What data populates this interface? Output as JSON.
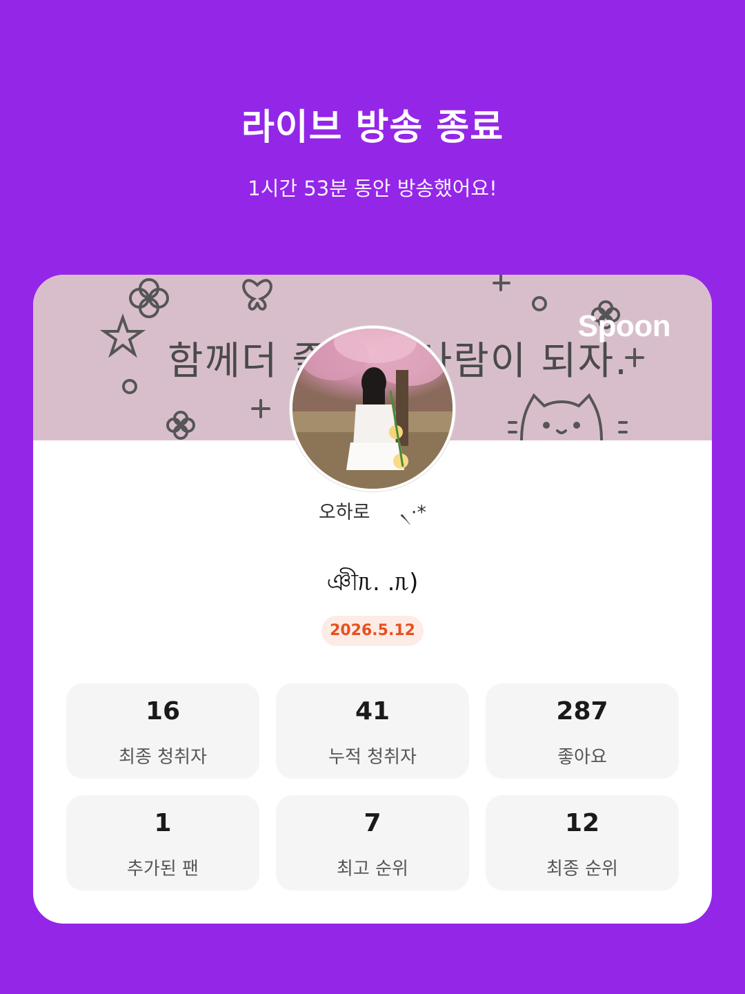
{
  "header": {
    "title": "라이브 방송 종료",
    "subtitle": "1시간 53분 동안 방송했어요!"
  },
  "card": {
    "banner_text": "함께더 즐거운 사람이 되자.",
    "brand": "Spoon",
    "nickname": "오하로     ৲·*",
    "live_title": "ঞীᥰ. .ᥰ)",
    "date": "2026.5.12",
    "stats": [
      {
        "value": "16",
        "label": "최종 청취자"
      },
      {
        "value": "41",
        "label": "누적 청취자"
      },
      {
        "value": "287",
        "label": "좋아요"
      },
      {
        "value": "1",
        "label": "추가된 팬"
      },
      {
        "value": "7",
        "label": "최고 순위"
      },
      {
        "value": "12",
        "label": "최종 순위"
      }
    ]
  },
  "colors": {
    "background": "#9426E8",
    "banner": "#D8BECB",
    "date_badge_bg": "#FDEBE5",
    "date_badge_text": "#E8501E",
    "stat_bg": "#F5F5F6"
  }
}
